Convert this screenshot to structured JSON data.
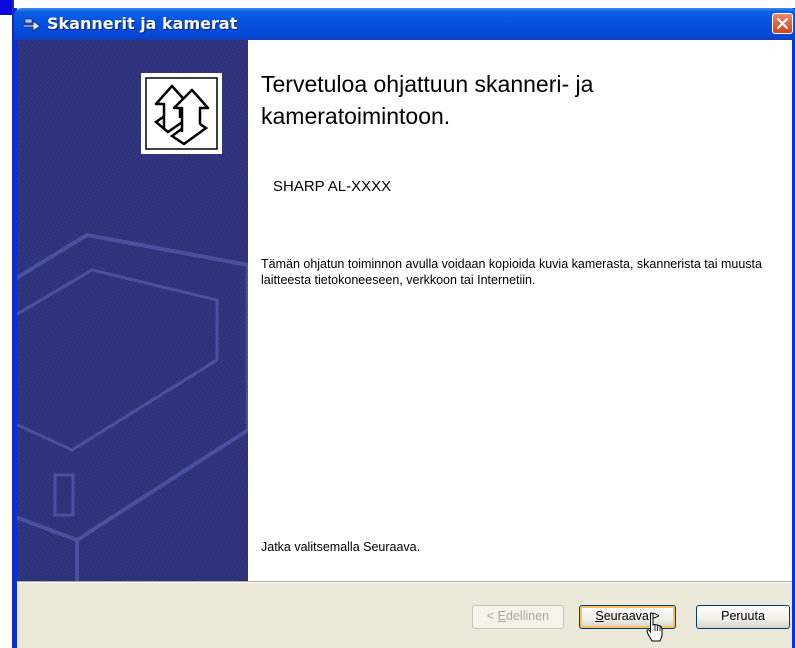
{
  "window": {
    "title": "Skannerit ja kamerat"
  },
  "wizard": {
    "heading": "Tervetuloa ohjattuun skanneri- ja kameratoimintoon.",
    "device_name": "SHARP AL-XXXX",
    "description": "Tämän ohjatun toiminnon avulla voidaan kopioida kuvia kamerasta, skannerista tai muusta laitteesta tietokoneeseen, verkkoon tai Internetiin.",
    "continue_hint": "Jatka valitsemalla Seuraava."
  },
  "buttons": {
    "back_prefix": "< ",
    "back_mnemonic": "E",
    "back_rest": "dellinen",
    "next_mnemonic": "S",
    "next_rest": "euraava >",
    "cancel": "Peruuta"
  },
  "colors": {
    "title_bar": "#0553e3",
    "sidebar": "#2a2f74",
    "dialog_background": "#ece9d8",
    "close_button": "#d64119"
  },
  "icons": {
    "title": "scanner-camera-arrow-icon",
    "wizard": "wizard-arrows-icon",
    "close": "close-icon",
    "cursor": "hand-pointer-cursor"
  }
}
